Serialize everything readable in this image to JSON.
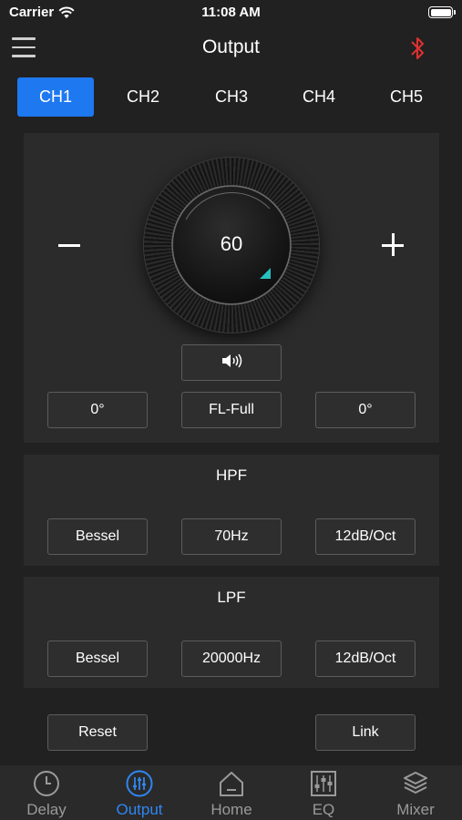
{
  "status_bar": {
    "carrier": "Carrier",
    "time": "11:08 AM"
  },
  "header": {
    "title": "Output",
    "menu_icon": "hamburger-menu-icon",
    "bluetooth_icon": "bluetooth-icon"
  },
  "colors": {
    "accent": "#1e78f0",
    "bluetooth": "#e03030",
    "knob_marker": "#27c0c0",
    "nav_active": "#2f86f2"
  },
  "tabs": [
    {
      "label": "CH1",
      "active": true
    },
    {
      "label": "CH2",
      "active": false
    },
    {
      "label": "CH3",
      "active": false
    },
    {
      "label": "CH4",
      "active": false
    },
    {
      "label": "CH5",
      "active": false
    }
  ],
  "volume": {
    "value": "60",
    "speaker_icon": "speaker-icon"
  },
  "main_controls": {
    "phase_left": "0°",
    "channel_assign": "FL-Full",
    "phase_right": "0°"
  },
  "hpf": {
    "title": "HPF",
    "type": "Bessel",
    "frequency": "70Hz",
    "slope": "12dB/Oct"
  },
  "lpf": {
    "title": "LPF",
    "type": "Bessel",
    "frequency": "20000Hz",
    "slope": "12dB/Oct"
  },
  "actions": {
    "reset": "Reset",
    "link": "Link"
  },
  "bottom_nav": [
    {
      "label": "Delay",
      "icon": "clock-icon",
      "active": false
    },
    {
      "label": "Output",
      "icon": "sliders-icon",
      "active": true
    },
    {
      "label": "Home",
      "icon": "home-icon",
      "active": false
    },
    {
      "label": "EQ",
      "icon": "equalizer-icon",
      "active": false
    },
    {
      "label": "Mixer",
      "icon": "layers-icon",
      "active": false
    }
  ]
}
